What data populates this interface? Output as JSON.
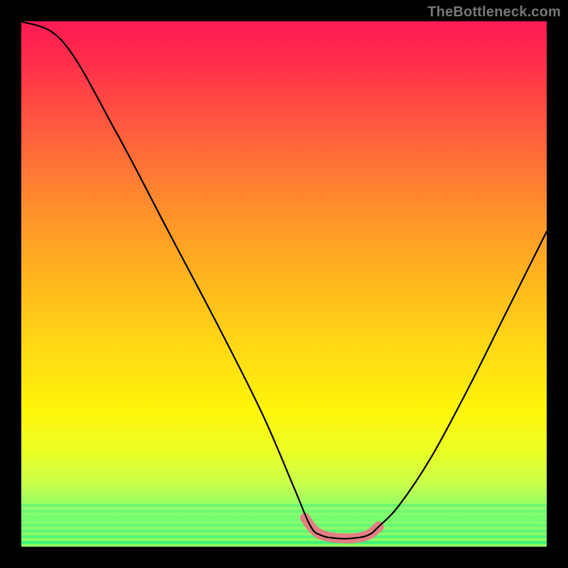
{
  "watermark": "TheBottleneck.com",
  "colors": {
    "frame": "#000000",
    "curve": "#000000",
    "zone": "#e37f83",
    "gradient_top": "#ff1a55",
    "gradient_bottom": "#37f47a"
  },
  "chart_data": {
    "type": "line",
    "title": "",
    "xlabel": "",
    "ylabel": "",
    "xlim": [
      0,
      100
    ],
    "ylim": [
      0,
      100
    ],
    "axes_visible": false,
    "grid": false,
    "background": "red-yellow-green vertical gradient (bottleneck heatmap style)",
    "description": "A black V-shaped curve descending steeply from upper-left to a flat bottom around x=55-66, then rising toward upper-right. A pink highlight marks the flat minimum region.",
    "series": [
      {
        "name": "bottleneck-curve",
        "points": [
          {
            "x": 0,
            "y": 100
          },
          {
            "x": 8,
            "y": 96
          },
          {
            "x": 18,
            "y": 79
          },
          {
            "x": 28,
            "y": 60
          },
          {
            "x": 38,
            "y": 41
          },
          {
            "x": 46,
            "y": 25
          },
          {
            "x": 52,
            "y": 11
          },
          {
            "x": 55,
            "y": 4
          },
          {
            "x": 57,
            "y": 2.2
          },
          {
            "x": 60,
            "y": 1.6
          },
          {
            "x": 63,
            "y": 1.6
          },
          {
            "x": 66,
            "y": 2.2
          },
          {
            "x": 68,
            "y": 3.8
          },
          {
            "x": 72,
            "y": 8
          },
          {
            "x": 78,
            "y": 17
          },
          {
            "x": 85,
            "y": 30
          },
          {
            "x": 92,
            "y": 44
          },
          {
            "x": 100,
            "y": 60
          }
        ]
      },
      {
        "name": "optimal-zone-highlight",
        "color": "#e37f83",
        "points": [
          {
            "x": 54,
            "y": 5.5
          },
          {
            "x": 55.5,
            "y": 3.4
          },
          {
            "x": 57,
            "y": 2.3
          },
          {
            "x": 59,
            "y": 1.8
          },
          {
            "x": 61,
            "y": 1.6
          },
          {
            "x": 63,
            "y": 1.6
          },
          {
            "x": 65,
            "y": 1.9
          },
          {
            "x": 66.5,
            "y": 2.5
          },
          {
            "x": 68,
            "y": 3.8
          }
        ]
      }
    ],
    "markers": [
      {
        "name": "zone-end-dot",
        "x": 68,
        "y": 3.8,
        "color": "#e37f83"
      }
    ]
  }
}
